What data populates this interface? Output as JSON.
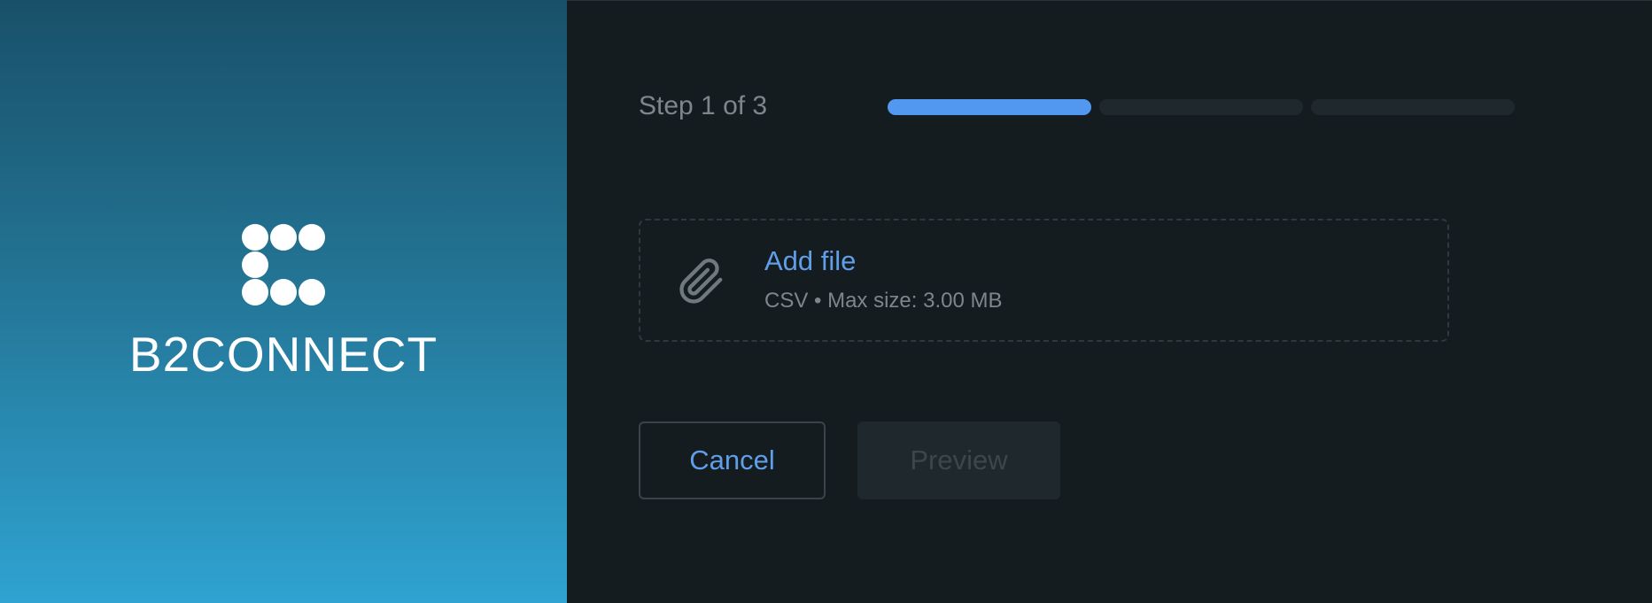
{
  "brand": {
    "name": "B2CONNECT",
    "logo_icon": "dots-c-logo-icon",
    "gradient_top": "#195069",
    "gradient_bottom": "#2fa3d2"
  },
  "wizard": {
    "step_label": "Step 1 of 3",
    "current_step": 1,
    "total_steps": 3,
    "progress_active_color": "#5398f0",
    "progress_inactive_color": "#1f282c"
  },
  "upload": {
    "icon": "paperclip-icon",
    "title": "Add file",
    "hint": "CSV • Max size: 3.00 MB"
  },
  "actions": {
    "cancel_label": "Cancel",
    "preview_label": "Preview",
    "preview_enabled": false
  },
  "colors": {
    "background": "#151c1f",
    "accent": "#5f9ee9",
    "muted_text": "#7c878d"
  }
}
